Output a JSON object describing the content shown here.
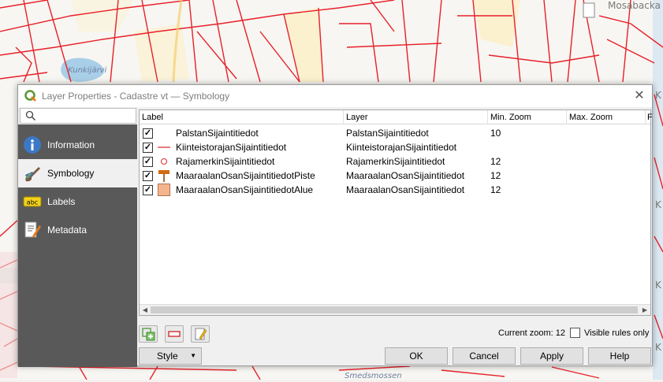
{
  "map": {
    "labels": [
      "Mosabacka",
      "Kunkijärvi",
      "Smedsmossen",
      "K",
      "K",
      "K",
      "K"
    ]
  },
  "dialog": {
    "title": "Layer Properties - Cadastre vt — Symbology",
    "close_glyph": "✕",
    "search_placeholder": ""
  },
  "sidebar": {
    "items": [
      {
        "label": "Information",
        "icon": "info-icon",
        "active": false
      },
      {
        "label": "Symbology",
        "icon": "paintbrush-icon",
        "active": true
      },
      {
        "label": "Labels",
        "icon": "labels-abc-icon",
        "active": false
      },
      {
        "label": "Metadata",
        "icon": "metadata-icon",
        "active": false
      }
    ]
  },
  "rules": {
    "headers": [
      "Label",
      "Layer",
      "Min. Zoom",
      "Max. Zoom",
      "F"
    ],
    "rows": [
      {
        "checked": "✓",
        "symbol": "none",
        "label": "PalstanSijaintitiedot",
        "layer": "PalstanSijaintitiedot",
        "min_zoom": "10",
        "max_zoom": ""
      },
      {
        "checked": "✓",
        "symbol": "line",
        "label": "KiinteistorajanSijaintitiedot",
        "layer": "KiinteistorajanSijaintitiedot",
        "min_zoom": "",
        "max_zoom": ""
      },
      {
        "checked": "✓",
        "symbol": "circle",
        "label": "RajamerkinSijaintitiedot",
        "layer": "RajamerkinSijaintitiedot",
        "min_zoom": "12",
        "max_zoom": ""
      },
      {
        "checked": "✓",
        "symbol": "pin",
        "label": "MaaraalanOsanSijaintitiedotPiste",
        "layer": "MaaraalanOsanSijaintitiedot",
        "min_zoom": "12",
        "max_zoom": ""
      },
      {
        "checked": "✓",
        "symbol": "fill",
        "label": "MaaraalanOsanSijaintitiedotAlue",
        "layer": "MaaraalanOsanSijaintitiedot",
        "min_zoom": "12",
        "max_zoom": ""
      }
    ]
  },
  "toolbar": {
    "current_zoom": "Current zoom: 12",
    "visible_rules_only": "Visible rules only"
  },
  "buttons": {
    "style": "Style",
    "ok": "OK",
    "cancel": "Cancel",
    "apply": "Apply",
    "help": "Help"
  },
  "colors": {
    "map_line": "#e8202a",
    "sidebar_bg": "#595959",
    "symbol_red": "#e05050",
    "pin_orange": "#d06a12",
    "fill_salmon": "#f4b58e"
  }
}
